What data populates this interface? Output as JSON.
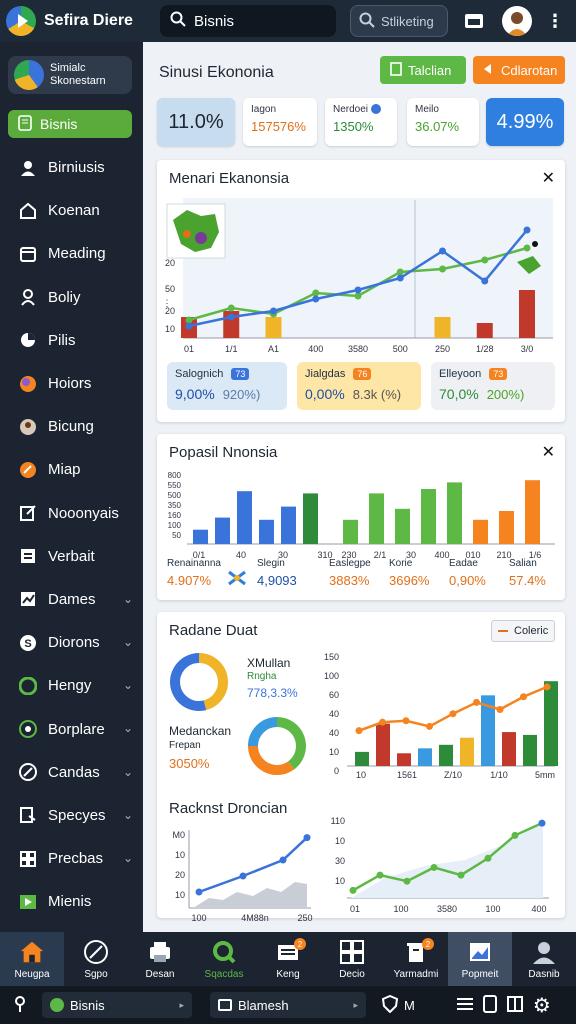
{
  "app": {
    "title": "Sefira Diere"
  },
  "topbar": {
    "search_value": "Bisnis",
    "search2_value": "Stliketing"
  },
  "sidebar": {
    "profile_line1": "Simialc",
    "profile_line2": "Skonestarn",
    "active_label": "Bisnis",
    "items": [
      {
        "label": "Birniusis",
        "icon": "user-icon",
        "chevron": false
      },
      {
        "label": "Koenan",
        "icon": "home-icon",
        "chevron": false
      },
      {
        "label": "Meading",
        "icon": "calendar-icon",
        "chevron": false
      },
      {
        "label": "Boliy",
        "icon": "person-icon",
        "chevron": false
      },
      {
        "label": "Pilis",
        "icon": "pie-icon",
        "chevron": false
      },
      {
        "label": "Hoiors",
        "icon": "globe-icon",
        "chevron": false
      },
      {
        "label": "Bicung",
        "icon": "portrait-icon",
        "chevron": false
      },
      {
        "label": "Miap",
        "icon": "map-icon",
        "chevron": false
      },
      {
        "label": "Nooonyais",
        "icon": "edit-icon",
        "chevron": false
      },
      {
        "label": "Verbait",
        "icon": "list-icon",
        "chevron": false
      },
      {
        "label": "Dames",
        "icon": "chart-icon",
        "chevron": true
      },
      {
        "label": "Diorons",
        "icon": "s-icon",
        "chevron": true
      },
      {
        "label": "Hengy",
        "icon": "leaf-icon",
        "chevron": true
      },
      {
        "label": "Borplare",
        "icon": "pin-icon",
        "chevron": true
      },
      {
        "label": "Candas",
        "icon": "wrench-icon",
        "chevron": true
      },
      {
        "label": "Specyes",
        "icon": "doc-icon",
        "chevron": true
      },
      {
        "label": "Precbas",
        "icon": "grid-icon",
        "chevron": true
      },
      {
        "label": "Mienis",
        "icon": "play-icon",
        "chevron": false
      }
    ]
  },
  "main": {
    "title": "Sinusi Ekononia",
    "btn_green": "Talclian",
    "btn_orange": "Cdlarotan",
    "kpis": [
      {
        "big": "11.0%"
      },
      {
        "label": "Iagon",
        "value": "157576%"
      },
      {
        "label": "Nerdoei",
        "value": "1350%"
      },
      {
        "label": "Meilo",
        "value": "36.07%"
      },
      {
        "big": "4.99%"
      }
    ],
    "panel1": {
      "title": "Menari Ekanonsia",
      "cards": [
        {
          "label": "Salognich",
          "badge": "73",
          "v1": "9,00%",
          "v2": "920%)"
        },
        {
          "label": "Jialgdas",
          "badge": "76",
          "v1": "0,00%",
          "v2": "8.3k (%)"
        },
        {
          "label": "Elleyoon",
          "badge": "73",
          "v1": "70,0%",
          "v2": "200%)"
        }
      ]
    },
    "panel2": {
      "title": "Popasil Nnonsia",
      "legend": [
        {
          "label": "Renainanna",
          "value": "4.907%"
        },
        {
          "label": "Slegin",
          "value": "4,9093"
        },
        {
          "label": "Easlegpe",
          "value": "3883%"
        },
        {
          "label": "Korie",
          "value": "3696%"
        },
        {
          "label": "Eadae",
          "value": "0,90%"
        },
        {
          "label": "Salian",
          "value": "57.4%"
        }
      ]
    },
    "panel3": {
      "title": "Radane Duat",
      "legend_btn": "Coleric",
      "donut1_title": "XMullan",
      "donut1_sub": "Rngha",
      "donut1_val": "778,3.3%",
      "donut2_title": "Medanckan",
      "donut2_sub": "Frepan",
      "donut2_val": "3050%",
      "sub_title": "Racknst Droncian"
    }
  },
  "bottom_nav": [
    {
      "label": "Neugpa",
      "icon": "home-icon",
      "badge": ""
    },
    {
      "label": "Sgpo",
      "icon": "compass-icon",
      "badge": ""
    },
    {
      "label": "Desan",
      "icon": "printer-icon",
      "badge": ""
    },
    {
      "label": "Sqacdas",
      "icon": "search-icon",
      "badge": ""
    },
    {
      "label": "Keng",
      "icon": "mail-icon",
      "badge": "2"
    },
    {
      "label": "Decio",
      "icon": "grid-icon",
      "badge": ""
    },
    {
      "label": "Yarmadmi",
      "icon": "trash-icon",
      "badge": "2"
    },
    {
      "label": "Popmeit",
      "icon": "image-icon",
      "badge": ""
    },
    {
      "label": "Dasnib",
      "icon": "user-icon",
      "badge": ""
    }
  ],
  "status_bar": {
    "field1": "Bisnis",
    "field2": "Blamesh",
    "mode": "M"
  },
  "chart_data": [
    {
      "type": "bar",
      "title": "Menari Ekanonsia",
      "x_ticks": [
        "01",
        "1/1",
        "A1",
        "400",
        "3580",
        "500",
        "250",
        "1/28",
        "3/0"
      ],
      "y_ticks": [
        "20",
        "50",
        "20",
        "10"
      ],
      "bars": [
        14,
        18,
        14,
        0,
        0,
        0,
        14,
        10,
        32
      ],
      "line_blue": [
        8,
        14,
        18,
        26,
        32,
        40,
        58,
        38,
        72
      ],
      "line_green": [
        12,
        20,
        16,
        30,
        28,
        44,
        46,
        52,
        60
      ]
    },
    {
      "type": "bar",
      "title": "Popasil Nnonsia",
      "y_ticks": [
        "800",
        "550",
        "500",
        "350",
        "160",
        "100",
        "50"
      ],
      "left_x_ticks": [
        "0/1",
        "40",
        "30",
        "310"
      ],
      "right_x_ticks": [
        "230",
        "2/1",
        "30",
        "400",
        "010",
        "210",
        "1/6"
      ],
      "left_bars": [
        13,
        24,
        48,
        22,
        34,
        46
      ],
      "right_bars": [
        22,
        46,
        32,
        50,
        56,
        22,
        30,
        58
      ]
    },
    {
      "type": "pie",
      "series": [
        {
          "name": "XMullan",
          "values": [
            46,
            54
          ]
        },
        {
          "name": "Medanckan",
          "values": [
            40,
            35,
            25
          ]
        }
      ]
    },
    {
      "type": "bar",
      "y_ticks": [
        "150",
        "100",
        "60",
        "40",
        "40",
        "10",
        "0"
      ],
      "x_ticks": [
        "10",
        "1561",
        "Z/10",
        "1/10",
        "5mm"
      ],
      "bars": [
        20,
        60,
        18,
        25,
        30,
        40,
        100,
        48,
        44,
        120
      ],
      "line": [
        50,
        62,
        64,
        56,
        74,
        90,
        80,
        98,
        112
      ]
    },
    {
      "type": "line",
      "title": "Racknst Droncian",
      "y_ticks": [
        "M0",
        "10",
        "20",
        "10"
      ],
      "x_ticks": [
        "100",
        "4M88n",
        "250"
      ],
      "values": [
        20,
        40,
        60,
        88
      ]
    },
    {
      "type": "line",
      "y_ticks": [
        "110",
        "10",
        "30",
        "10"
      ],
      "x_ticks": [
        "01",
        "100",
        "3580",
        "100",
        "400"
      ],
      "values": [
        10,
        30,
        22,
        40,
        30,
        52,
        82,
        98
      ]
    }
  ]
}
